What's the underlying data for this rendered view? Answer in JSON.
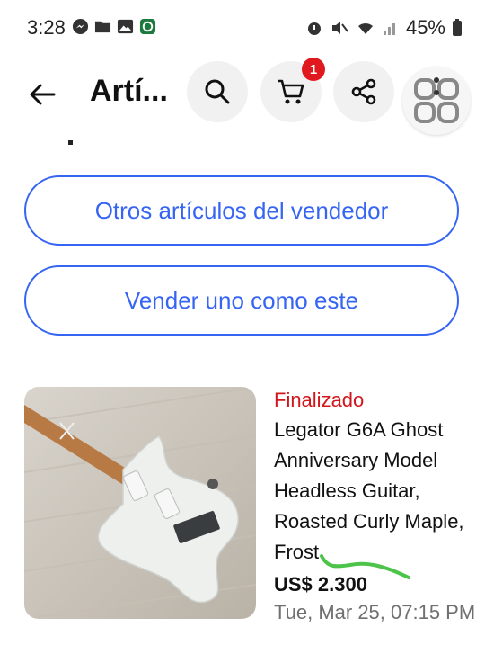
{
  "status_bar": {
    "time": "3:28",
    "battery": "45%",
    "left_icons": [
      "messenger-icon",
      "folder-icon",
      "image-icon",
      "app-icon"
    ],
    "right_icons": [
      "alarm-icon",
      "mute-icon",
      "wifi-icon",
      "signal-icon",
      "battery-icon"
    ]
  },
  "header": {
    "title": "Artí...",
    "cart_count": "1",
    "icons": [
      "back-arrow-icon",
      "search-icon",
      "cart-icon",
      "share-icon",
      "apps-grid-icon"
    ]
  },
  "buttons": {
    "seller_items": "Otros artículos del vendedor",
    "sell_one": "Vender uno como este"
  },
  "listing": {
    "status": "Finalizado",
    "title": "Legator G6A Ghost Anniversary Model Headless Guitar, Roasted Curly Maple, Frost",
    "price": "US$ 2.300",
    "date": "Tue, Mar 25, 07:15 PM"
  },
  "colors": {
    "accent": "#3665f3",
    "status_red": "#d1161c",
    "badge_red": "#e0191f",
    "annotation_green": "#4cc44a"
  }
}
